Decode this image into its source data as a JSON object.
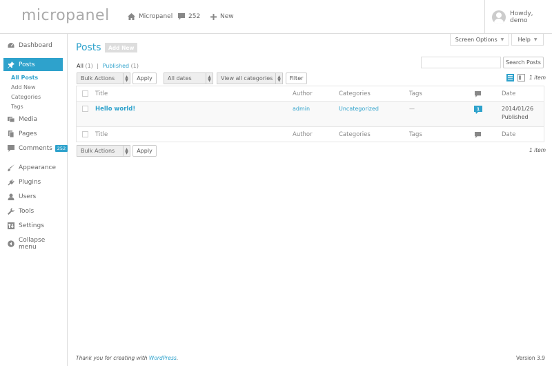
{
  "topbar": {
    "logo": "micropanel",
    "site_name": "Micropanel",
    "comments_count": "252",
    "new_label": "New",
    "howdy": "Howdy, demo"
  },
  "sidebar": {
    "dashboard": "Dashboard",
    "posts": "Posts",
    "posts_sub": [
      "All Posts",
      "Add New",
      "Categories",
      "Tags"
    ],
    "media": "Media",
    "pages": "Pages",
    "comments": "Comments",
    "comments_badge": "252",
    "appearance": "Appearance",
    "plugins": "Plugins",
    "users": "Users",
    "tools": "Tools",
    "settings": "Settings",
    "collapse": "Collapse menu"
  },
  "screen_tabs": {
    "screen_options": "Screen Options",
    "help": "Help"
  },
  "main": {
    "title": "Posts",
    "add_new": "Add New",
    "filter_all": "All",
    "filter_all_count": "(1)",
    "filter_sep": "|",
    "filter_published": "Published",
    "filter_published_count": "(1)",
    "search_button": "Search Posts",
    "search_value": "",
    "bulk_actions": "Bulk Actions",
    "apply": "Apply",
    "all_dates": "All dates",
    "all_categories": "View all categories",
    "filter": "Filter",
    "items_count": "1 item"
  },
  "table": {
    "columns": {
      "title": "Title",
      "author": "Author",
      "categories": "Categories",
      "tags": "Tags",
      "date": "Date"
    },
    "rows": [
      {
        "title": "Hello world!",
        "author": "admin",
        "categories": "Uncategorized",
        "tags": "—",
        "comments": "1",
        "date": "2014/01/26",
        "status": "Published"
      }
    ]
  },
  "footer": {
    "thanks_prefix": "Thank you for creating with",
    "wordpress": "WordPress",
    "thanks_suffix": ".",
    "version": "Version 3.9"
  },
  "colors": {
    "accent": "#2ea2cc"
  }
}
